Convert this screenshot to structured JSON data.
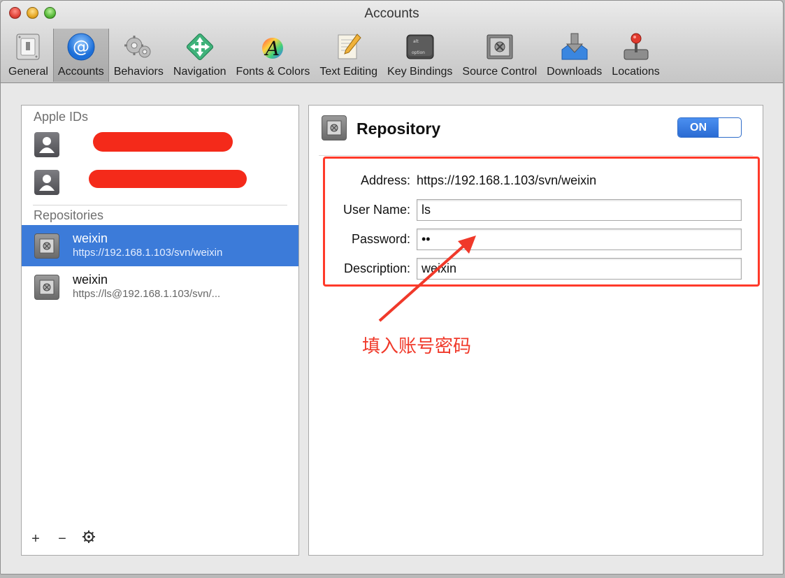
{
  "window": {
    "title": "Accounts"
  },
  "toolbar": {
    "items": [
      {
        "label": "General"
      },
      {
        "label": "Accounts"
      },
      {
        "label": "Behaviors"
      },
      {
        "label": "Navigation"
      },
      {
        "label": "Fonts & Colors"
      },
      {
        "label": "Text Editing"
      },
      {
        "label": "Key Bindings"
      },
      {
        "label": "Source Control"
      },
      {
        "label": "Downloads"
      },
      {
        "label": "Locations"
      }
    ],
    "selected": "Accounts"
  },
  "sidebar": {
    "apple_ids_title": "Apple IDs",
    "repositories_title": "Repositories",
    "repositories": [
      {
        "name": "weixin",
        "url": "https://192.168.1.103/svn/weixin",
        "selected": true
      },
      {
        "name": "weixin",
        "url": "https://ls@192.168.1.103/svn/...",
        "selected": false
      }
    ],
    "footer": {
      "add": "+",
      "remove": "−"
    }
  },
  "detail": {
    "title": "Repository",
    "toggle": "ON",
    "fields": {
      "address_label": "Address:",
      "address_value": "https://192.168.1.103/svn/weixin",
      "username_label": "User Name:",
      "username_value": "ls",
      "password_label": "Password:",
      "password_value": "••",
      "description_label": "Description:",
      "description_value": "weixin"
    }
  },
  "annotation": {
    "text": "填入账号密码",
    "color": "#f0392a"
  },
  "colors": {
    "selection": "#3c7bd9",
    "redaction": "#f42a1a",
    "toggle_on": "#2a6bd3"
  }
}
